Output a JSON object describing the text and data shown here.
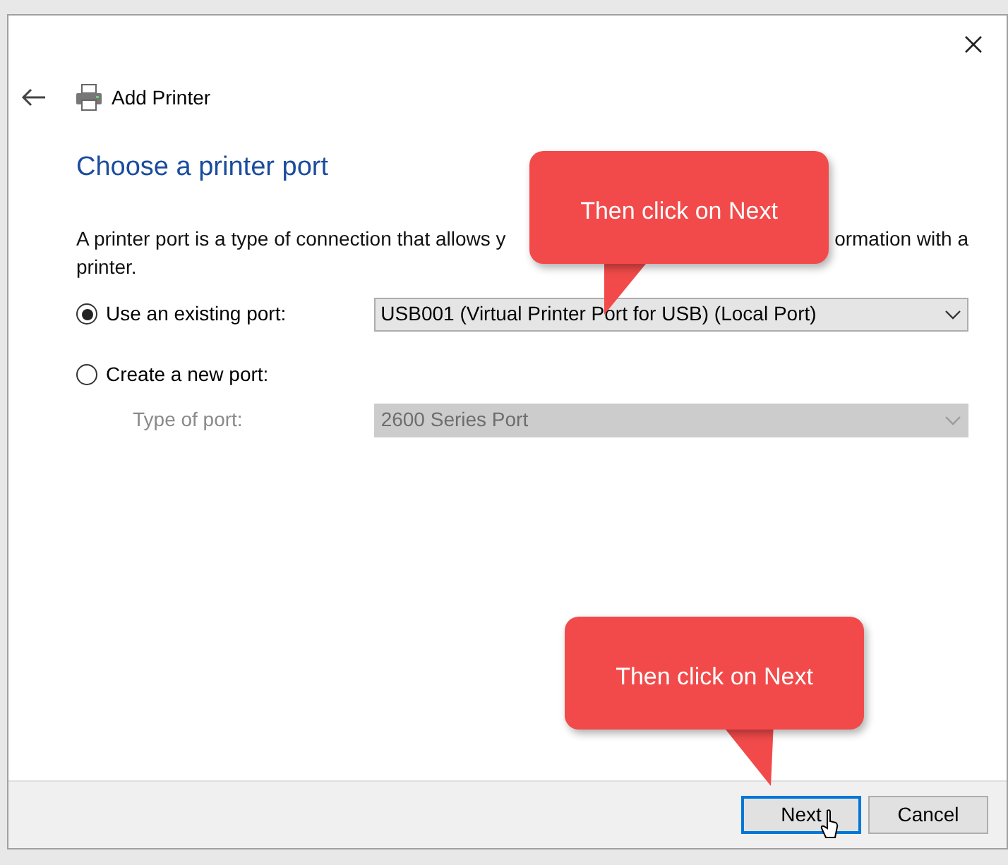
{
  "window": {
    "title": "Add Printer"
  },
  "heading": "Choose a printer port",
  "description": {
    "line_1_left": "A printer port is a type of connection that allows y",
    "line_1_right": "ormation with a",
    "line_2": "printer."
  },
  "options": [
    {
      "label": "Use an existing port:",
      "selected": true,
      "dropdown": {
        "value": "USB001 (Virtual Printer Port for USB) (Local Port)",
        "disabled": false
      }
    },
    {
      "label": "Create a new port:",
      "selected": false,
      "sub_label": "Type of port:",
      "dropdown": {
        "value": "2600 Series Port",
        "disabled": true
      }
    }
  ],
  "callouts": [
    {
      "text": "Then click on Next"
    },
    {
      "text": "Then click on Next"
    }
  ],
  "buttons": [
    {
      "label": "Next",
      "default": true
    },
    {
      "label": "Cancel",
      "default": false
    }
  ]
}
